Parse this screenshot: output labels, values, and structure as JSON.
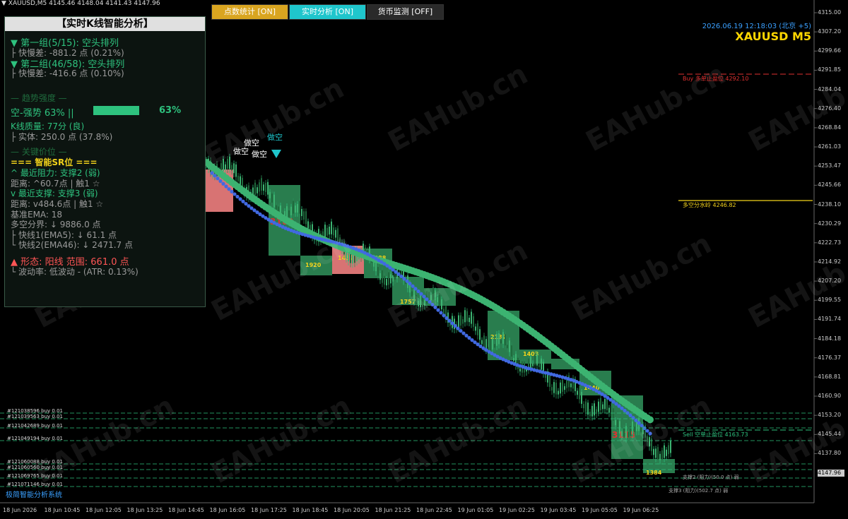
{
  "symbol_header": "▼ XAUUSD,M5  4145.46 4148.04 4141.43 4147.96",
  "buttons": {
    "b1": "点数统计 [ON]",
    "b2": "实时分析 [ON]",
    "b3": "货币监测 [OFF]"
  },
  "datetime": "2026.06.19 12:18:03 (北京 +5)",
  "symbol_big": "XAUUSD M5",
  "panel": {
    "title": "【实时K线智能分析】",
    "g1": "▼ 第一组(5/15): 空头排列",
    "g1s": "├ 快慢差: -881.2 点 (0.21%)",
    "g2": "▼ 第二组(46/58): 空头排列",
    "g2s": "├ 快慢差: -416.6 点 (0.10%)",
    "trend_hdr": "— 趋势强度 —",
    "strength": "空-强势 63% ||",
    "strength_pct": "63%",
    "kq": "K线质量: 77分 (良)",
    "body": "├ 实体: 250.0 点 (37.8%)",
    "key_hdr": "— 关键价位 —",
    "sr": "=== 智能SR位 ===",
    "res": "^ 最近阻力: 支撑2 (弱)",
    "res_d": "距离: ^60.7点 | 触1 ☆",
    "sup": "v 最近支撑: 支撑3 (弱)",
    "sup_d": "距离: v484.6点 | 触1 ☆",
    "ema": "基准EMA: 18",
    "div": "多空分界: ↓ 9886.0 点",
    "f1": "├ 快线1(EMA5): ↓ 61.1 点",
    "f2": "└ 快线2(EMA46): ↓ 2471.7 点",
    "shape": "▲ 形态: 阳线 范围: 661.0 点",
    "vol": "└ 波动率: 低波动 - (ATR: 0.13%)"
  },
  "footer": "极简智能分析系统",
  "price_labels": [
    "4315.00",
    "4307.20",
    "4299.66",
    "4291.85",
    "4284.04",
    "4276.40",
    "4268.84",
    "4261.03",
    "4253.47",
    "4245.66",
    "4238.10",
    "4230.29",
    "4222.73",
    "4214.92",
    "4207.20",
    "4199.55",
    "4191.74",
    "4184.18",
    "4176.37",
    "4168.81",
    "4160.90",
    "4153.20",
    "4145.44",
    "4137.80"
  ],
  "current_price": "4147.96",
  "time_labels": [
    "18 Jun 2026",
    "18 Jun 10:45",
    "18 Jun 12:05",
    "18 Jun 13:25",
    "18 Jun 14:45",
    "18 Jun 16:05",
    "18 Jun 17:25",
    "18 Jun 18:45",
    "18 Jun 20:05",
    "18 Jun 21:25",
    "18 Jun 22:45",
    "19 Jun 01:05",
    "19 Jun 02:25",
    "19 Jun 03:45",
    "19 Jun 05:05",
    "19 Jun 06:25"
  ],
  "orders": [
    "#121038596 buy 0.01",
    "#121039563 buy 0.01",
    "#121042689 buy 0.01",
    "#121049194 buy 0.01",
    "#121060088 buy 0.01",
    "#121060560 buy 0.01",
    "#121069765 buy 0.01",
    "#121071146 buy 0.01"
  ],
  "line_labels": {
    "buy_sl": "Buy 多单止盈位 4292.10",
    "split": "多空分水岭 4246.82",
    "sell_sl": "Sell 空单止盈位 4163.73",
    "sup2": "支撑2 (阻力)(50.0 点) 弱",
    "sup3": "支撑3 (阻力)(502.7 点) 弱"
  },
  "box_labels": [
    "3163",
    "1920",
    "1452",
    "1488",
    "1757",
    "2132",
    "1403",
    "1440",
    "3115",
    "1384"
  ],
  "signal_labels": [
    "做空",
    "做空",
    "做空",
    "做空"
  ],
  "watermark": "EAHub.cn",
  "colors": {
    "bull": "#2e8b57",
    "bear": "#f08080",
    "ema_outer": "#3cb371",
    "ema_inner": "#4169e1",
    "grid": "#1a1a1a"
  }
}
